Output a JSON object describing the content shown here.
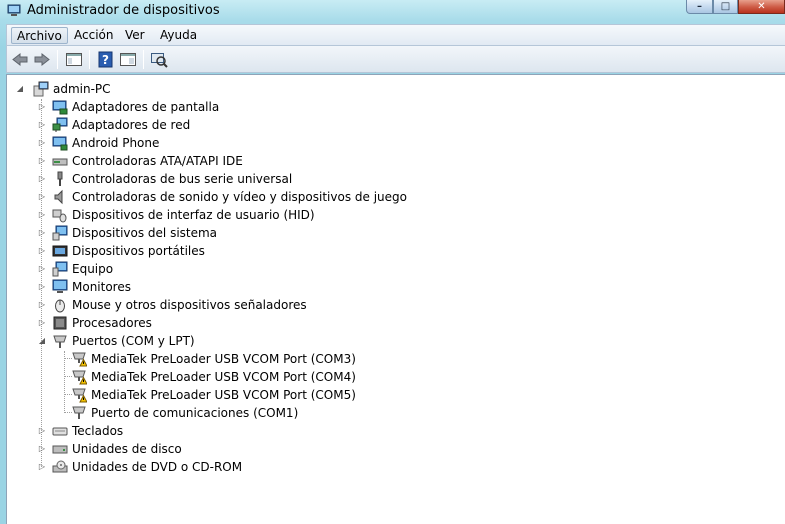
{
  "window": {
    "title": "Administrador de dispositivos",
    "controls": {
      "minimize": "–",
      "maximize": "□",
      "close": "✕"
    }
  },
  "menu": {
    "items": [
      "Archivo",
      "Acción",
      "Ver",
      "Ayuda"
    ],
    "active_index": 0
  },
  "toolbar": {
    "buttons": [
      "back-icon",
      "forward-icon",
      "console-tree-icon",
      "help-icon",
      "properties-icon",
      "scan-hardware-icon"
    ]
  },
  "tree": {
    "root": {
      "label": "admin-PC",
      "icon": "computer-icon",
      "expanded": true
    },
    "categories": [
      {
        "label": "Adaptadores de pantalla",
        "icon": "display-adapter-icon"
      },
      {
        "label": "Adaptadores de red",
        "icon": "network-adapter-icon"
      },
      {
        "label": "Android Phone",
        "icon": "android-phone-icon"
      },
      {
        "label": "Controladoras ATA/ATAPI IDE",
        "icon": "ide-controller-icon"
      },
      {
        "label": "Controladoras de bus serie universal",
        "icon": "usb-icon"
      },
      {
        "label": "Controladoras de sonido y vídeo y dispositivos de juego",
        "icon": "speaker-icon"
      },
      {
        "label": "Dispositivos de interfaz de usuario (HID)",
        "icon": "hid-icon"
      },
      {
        "label": "Dispositivos del sistema",
        "icon": "system-device-icon"
      },
      {
        "label": "Dispositivos portátiles",
        "icon": "portable-device-icon"
      },
      {
        "label": "Equipo",
        "icon": "computer-icon"
      },
      {
        "label": "Monitores",
        "icon": "monitor-icon"
      },
      {
        "label": "Mouse y otros dispositivos señaladores",
        "icon": "mouse-icon"
      },
      {
        "label": "Procesadores",
        "icon": "processor-icon"
      },
      {
        "label": "Puertos (COM y LPT)",
        "icon": "port-icon",
        "expanded": true,
        "children": [
          {
            "label": "MediaTek PreLoader USB VCOM Port (COM3)",
            "icon": "port-warning-icon",
            "warning": true
          },
          {
            "label": "MediaTek PreLoader USB VCOM Port (COM4)",
            "icon": "port-warning-icon",
            "warning": true
          },
          {
            "label": "MediaTek PreLoader USB VCOM Port (COM5)",
            "icon": "port-warning-icon",
            "warning": true
          },
          {
            "label": "Puerto de comunicaciones (COM1)",
            "icon": "port-icon",
            "warning": false
          }
        ]
      },
      {
        "label": "Teclados",
        "icon": "keyboard-icon"
      },
      {
        "label": "Unidades de disco",
        "icon": "disk-drive-icon"
      },
      {
        "label": "Unidades de DVD o CD-ROM",
        "icon": "dvd-drive-icon"
      }
    ]
  }
}
